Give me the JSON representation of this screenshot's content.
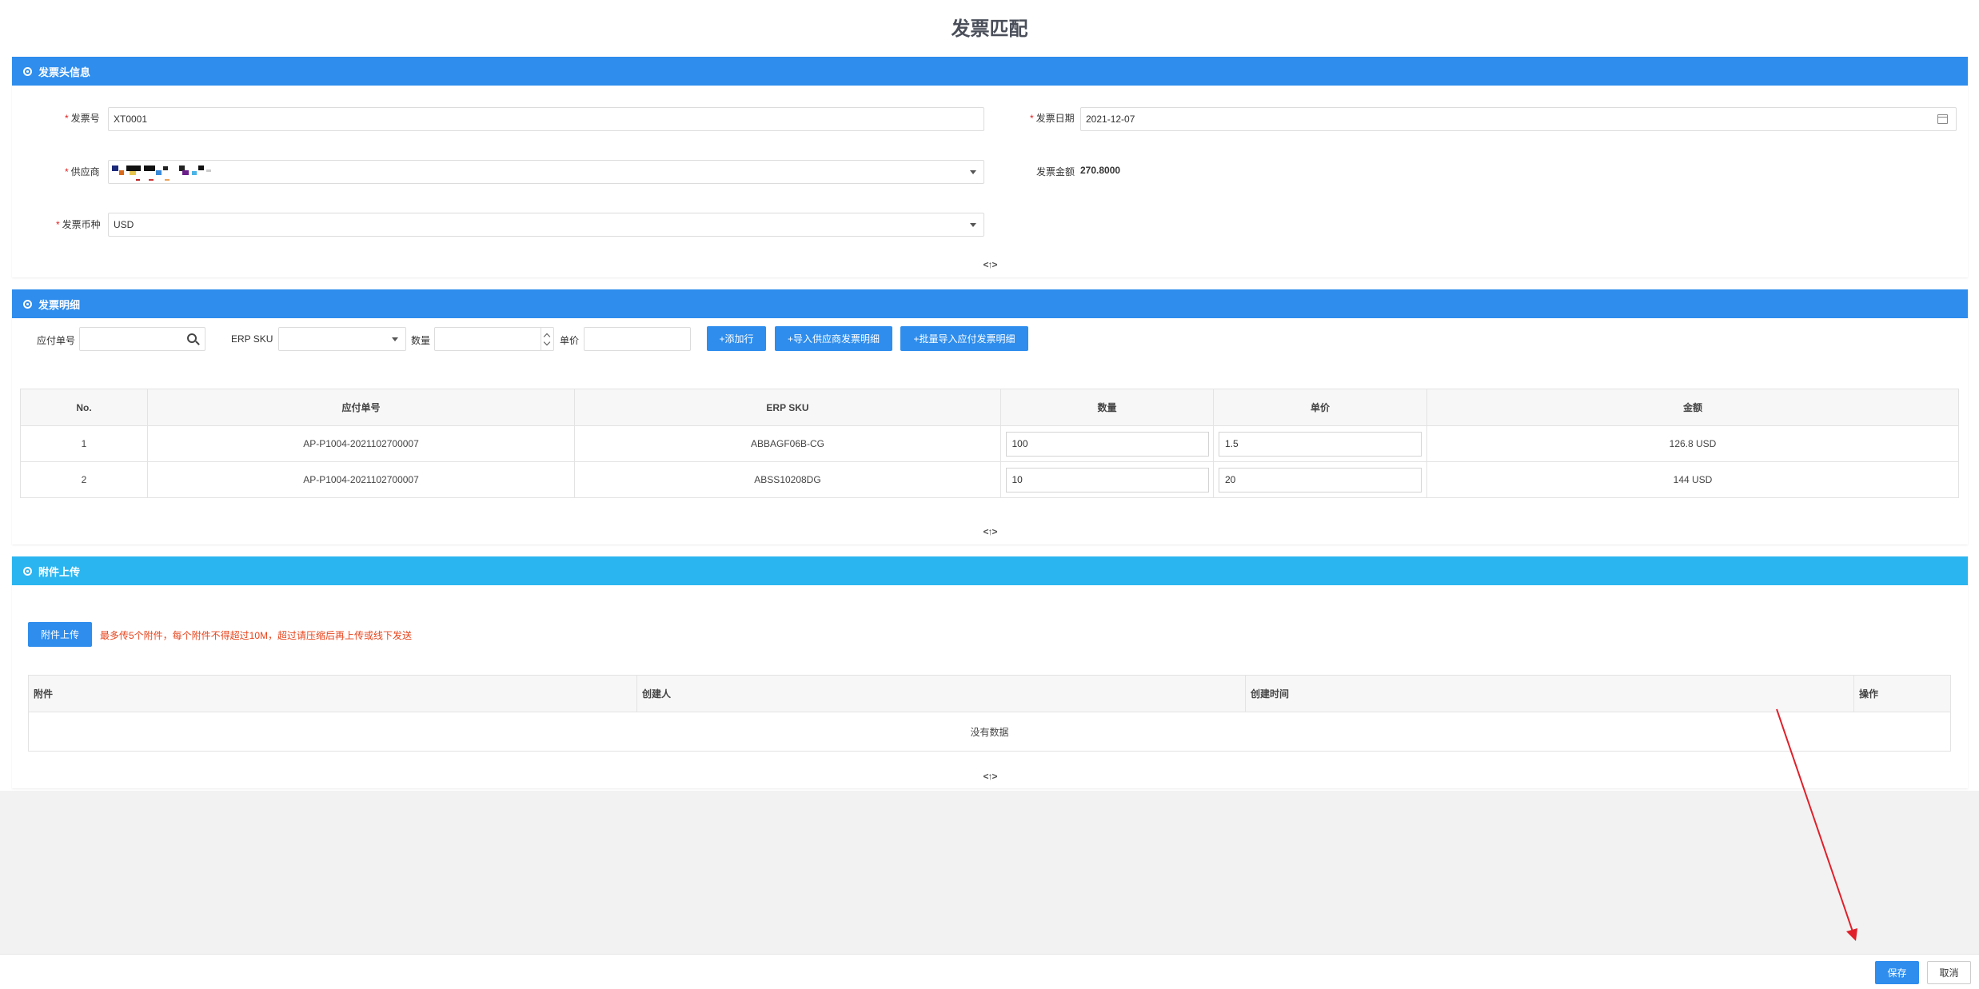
{
  "page": {
    "title": "发票匹配"
  },
  "header_panel": {
    "title": "发票头信息",
    "invoice_no": {
      "label": "发票号",
      "value": "XT0001"
    },
    "invoice_date": {
      "label": "发票日期",
      "value": "2021-12-07"
    },
    "supplier": {
      "label": "供应商"
    },
    "amount": {
      "label": "发票金额",
      "value": "270.8000"
    },
    "currency": {
      "label": "发票币种",
      "value": "USD"
    },
    "toggle": "<↑>"
  },
  "detail_panel": {
    "title": "发票明细",
    "filters": {
      "payable_no_label": "应付单号",
      "erp_sku_label": "ERP SKU",
      "qty_label": "数量",
      "price_label": "单价"
    },
    "buttons": {
      "add_row": "+添加行",
      "import_supplier": "+导入供应商发票明细",
      "batch_import": "+批量导入应付发票明细"
    },
    "columns": [
      "No.",
      "应付单号",
      "ERP SKU",
      "数量",
      "单价",
      "金额"
    ],
    "rows": [
      {
        "no": "1",
        "payable_no": "AP-P1004-2021102700007",
        "sku": "ABBAGF06B-CG",
        "qty": "100",
        "price": "1.5",
        "amount": "126.8 USD"
      },
      {
        "no": "2",
        "payable_no": "AP-P1004-2021102700007",
        "sku": "ABSS10208DG",
        "qty": "10",
        "price": "20",
        "amount": "144 USD"
      }
    ],
    "toggle": "<↑>"
  },
  "attachment_panel": {
    "title": "附件上传",
    "upload_button": "附件上传",
    "hint": "最多传5个附件，每个附件不得超过10M，超过请压缩后再上传或线下发送",
    "columns": [
      "附件",
      "创建人",
      "创建时间",
      "操作"
    ],
    "empty_text": "没有数据",
    "toggle": "<↑>"
  },
  "footer": {
    "save": "保存",
    "cancel": "取消"
  },
  "colors": {
    "primary": "#2e8ded",
    "panel_light": "#2bb5f0",
    "warn": "#e8441c",
    "annotation": "#e0202a"
  }
}
